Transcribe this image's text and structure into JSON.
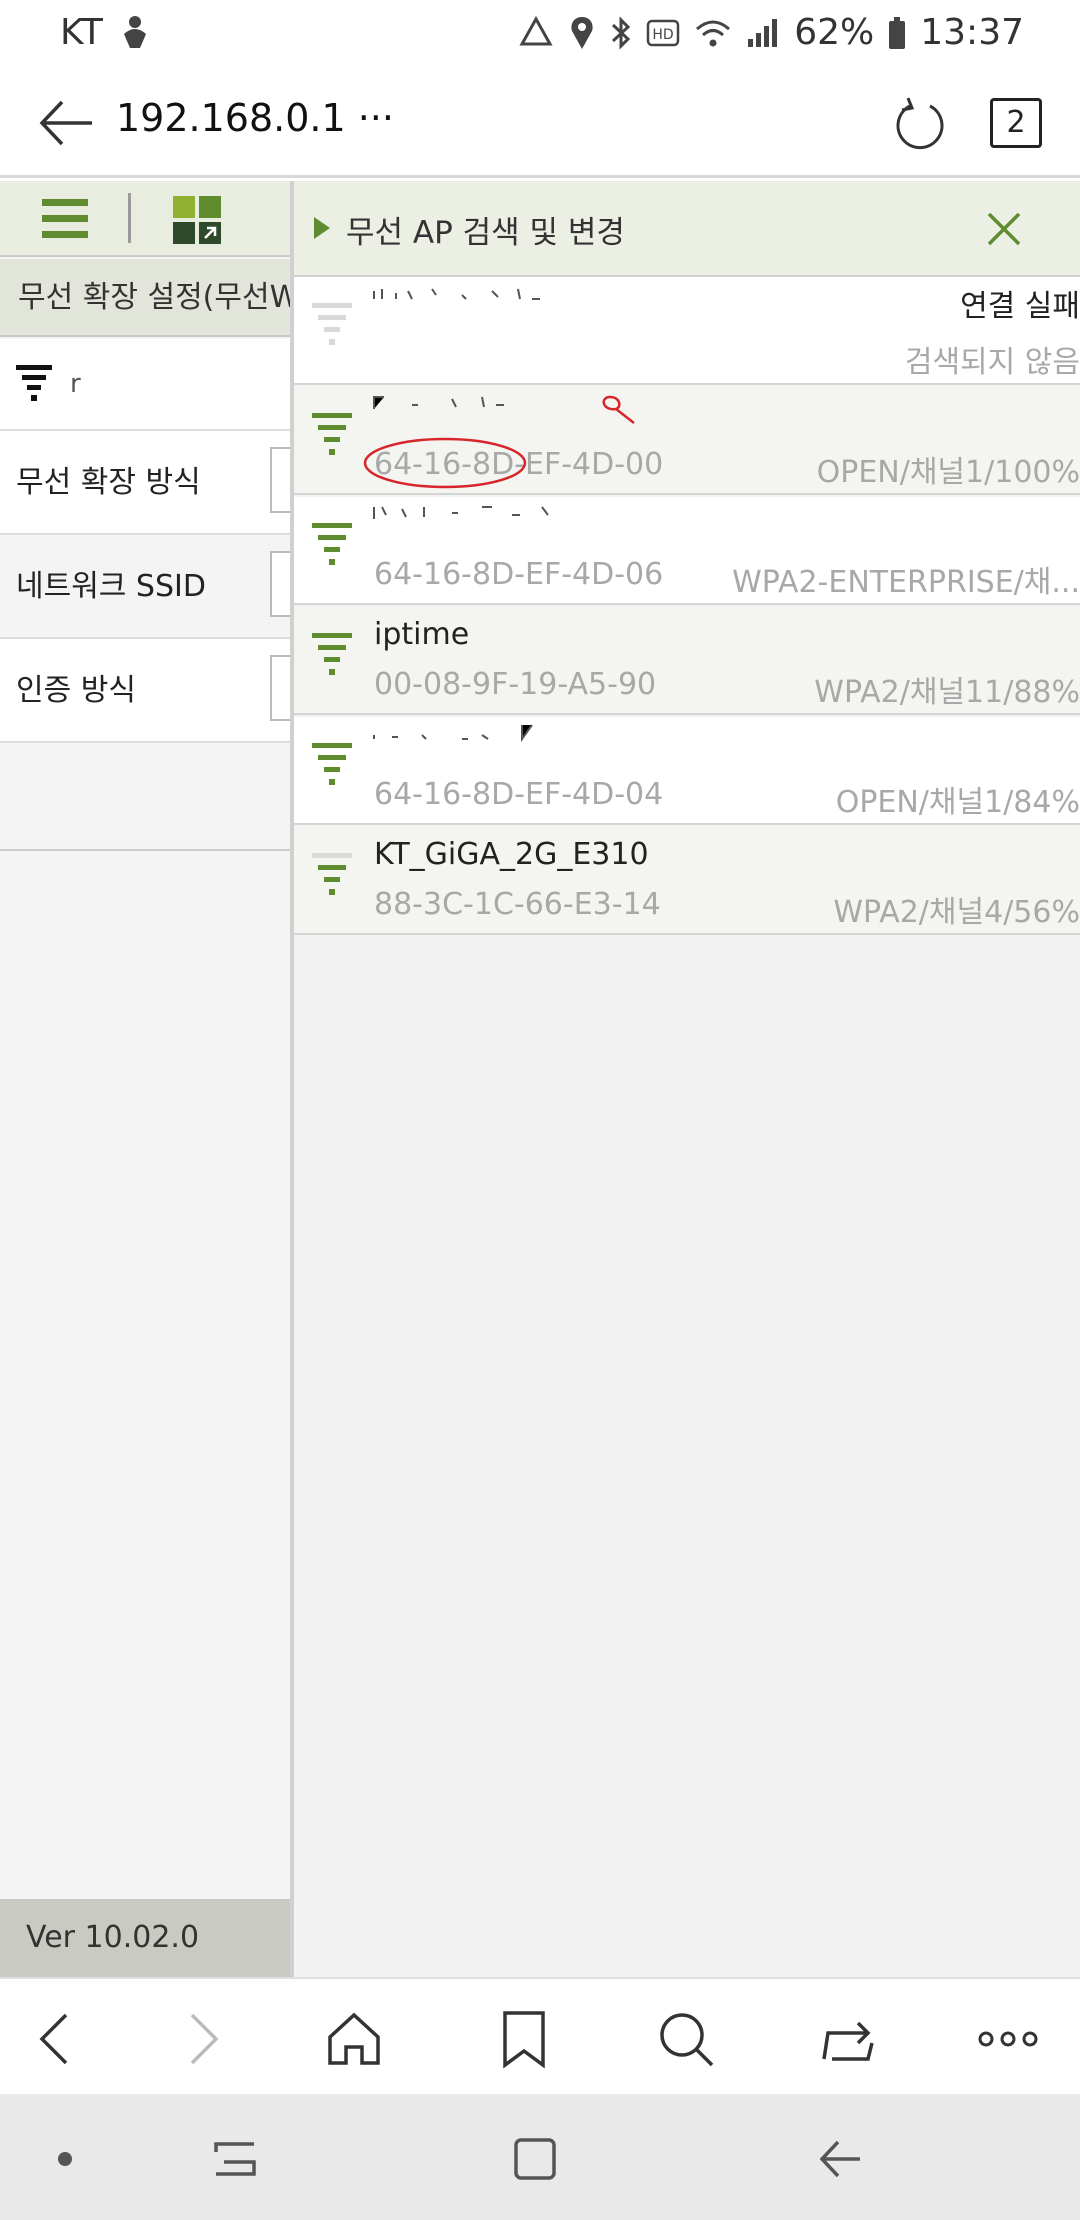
{
  "status_bar": {
    "carrier": "KT",
    "battery": "62%",
    "time": "13:37",
    "icons": [
      "usb-debug-icon",
      "recycle-icon",
      "location-icon",
      "bluetooth-icon",
      "hd-icon",
      "wifi-icon",
      "signal-icon",
      "battery-icon"
    ]
  },
  "browser": {
    "url": "192.168.0.1 ···",
    "tab_count": "2"
  },
  "left_page": {
    "title": "무선 확장 설정(무선W",
    "ssid_partial": "r",
    "rows": [
      {
        "label": "무선 확장 방식"
      },
      {
        "label": "네트워크 SSID"
      },
      {
        "label": "인증 방식"
      }
    ],
    "version": "Ver 10.02.0"
  },
  "panel": {
    "title": "무선 AP 검색 및 변경",
    "colors": {
      "accent": "#5f8c2f",
      "muted_signal": "#d9d9d9",
      "annotation": "#d6252b"
    },
    "access_points": [
      {
        "ssid": "",
        "mac": "",
        "status": "연결 실패",
        "info": "검색되지 않음",
        "signal": "none"
      },
      {
        "ssid": "",
        "mac": "64-16-8D-EF-4D-00",
        "status": "",
        "info": "OPEN/채널1/100%",
        "signal": "full"
      },
      {
        "ssid": "",
        "mac": "64-16-8D-EF-4D-06",
        "status": "",
        "info": "WPA2-ENTERPRISE/채...",
        "signal": "full"
      },
      {
        "ssid": "iptime",
        "mac": "00-08-9F-19-A5-90",
        "status": "",
        "info": "WPA2/채널11/88%",
        "signal": "full"
      },
      {
        "ssid": "",
        "mac": "64-16-8D-EF-4D-04",
        "status": "",
        "info": "OPEN/채널1/84%",
        "signal": "full"
      },
      {
        "ssid": "KT_GiGA_2G_E310",
        "mac": "88-3C-1C-66-E3-14",
        "status": "",
        "info": "WPA2/채널4/56%",
        "signal": "partial"
      }
    ]
  }
}
